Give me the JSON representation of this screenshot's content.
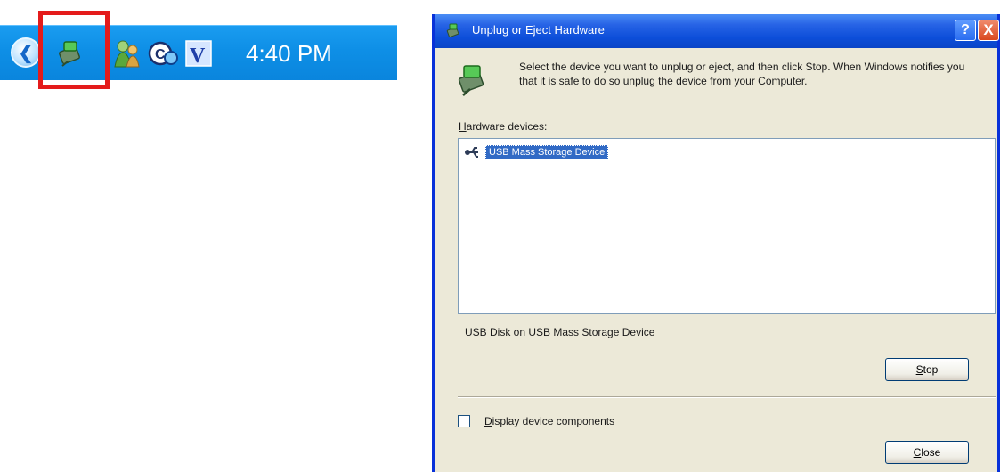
{
  "taskbar": {
    "clock": "4:40 PM",
    "icons": [
      "back-arrow-icon",
      "safely-remove-hardware-icon",
      "messenger-icon",
      "network-icon",
      "v-app-icon"
    ]
  },
  "dialog": {
    "title": "Unplug or Eject Hardware",
    "help_label": "?",
    "close_label": "X",
    "instruction": "Select the device you want to unplug or eject, and then click Stop. When Windows notifies you that it is safe to do so unplug the device from your Computer.",
    "hardware_label_first": "H",
    "hardware_label_rest": "ardware devices:",
    "devices": [
      {
        "label": "USB Mass Storage Device",
        "icon": "usb-icon",
        "selected": true
      }
    ],
    "device_description": "USB Disk on USB Mass Storage Device",
    "stop_first": "S",
    "stop_rest": "top",
    "checkbox_first": "D",
    "checkbox_rest": "isplay device components",
    "checkbox_checked": false,
    "close_first": "C",
    "close_rest": "lose"
  },
  "colors": {
    "taskbar_blue": "#0e8fe6",
    "highlight_red": "#e41b1b",
    "titlebar_blue": "#0c4ed9",
    "selection_blue": "#316ac5",
    "dialog_bg": "#ece9d8"
  }
}
